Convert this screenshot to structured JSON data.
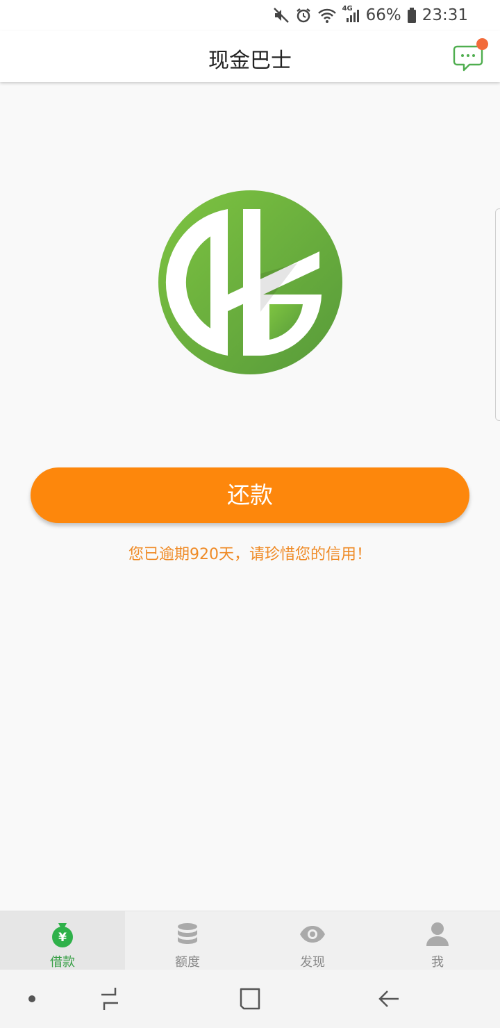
{
  "status_bar": {
    "icons": [
      "mute-icon",
      "alarm-icon",
      "wifi-icon",
      "signal-4g-icon",
      "battery-icon"
    ],
    "network_label": "4G",
    "battery_percent": "66%",
    "time": "23:31"
  },
  "header": {
    "title": "现金巴士",
    "message_icon": "chat-bubble-icon",
    "has_unread": true
  },
  "main": {
    "repay_label": "还款",
    "overdue_message": "您已逾期920天，请珍惜您的信用！"
  },
  "bottom_nav": {
    "items": [
      {
        "label": "借款",
        "icon": "money-bag-icon",
        "active": true
      },
      {
        "label": "额度",
        "icon": "coin-stack-icon",
        "active": false
      },
      {
        "label": "发现",
        "icon": "eye-icon",
        "active": false
      },
      {
        "label": "我",
        "icon": "person-icon",
        "active": false
      }
    ]
  },
  "system_nav": {
    "buttons": [
      "dot-icon",
      "recents-icon",
      "home-icon",
      "back-icon"
    ]
  },
  "colors": {
    "accent_orange": "#fd870c",
    "brand_green": "#62ab3e",
    "active_green": "#3aa048",
    "notification_red": "#f26b3a"
  }
}
